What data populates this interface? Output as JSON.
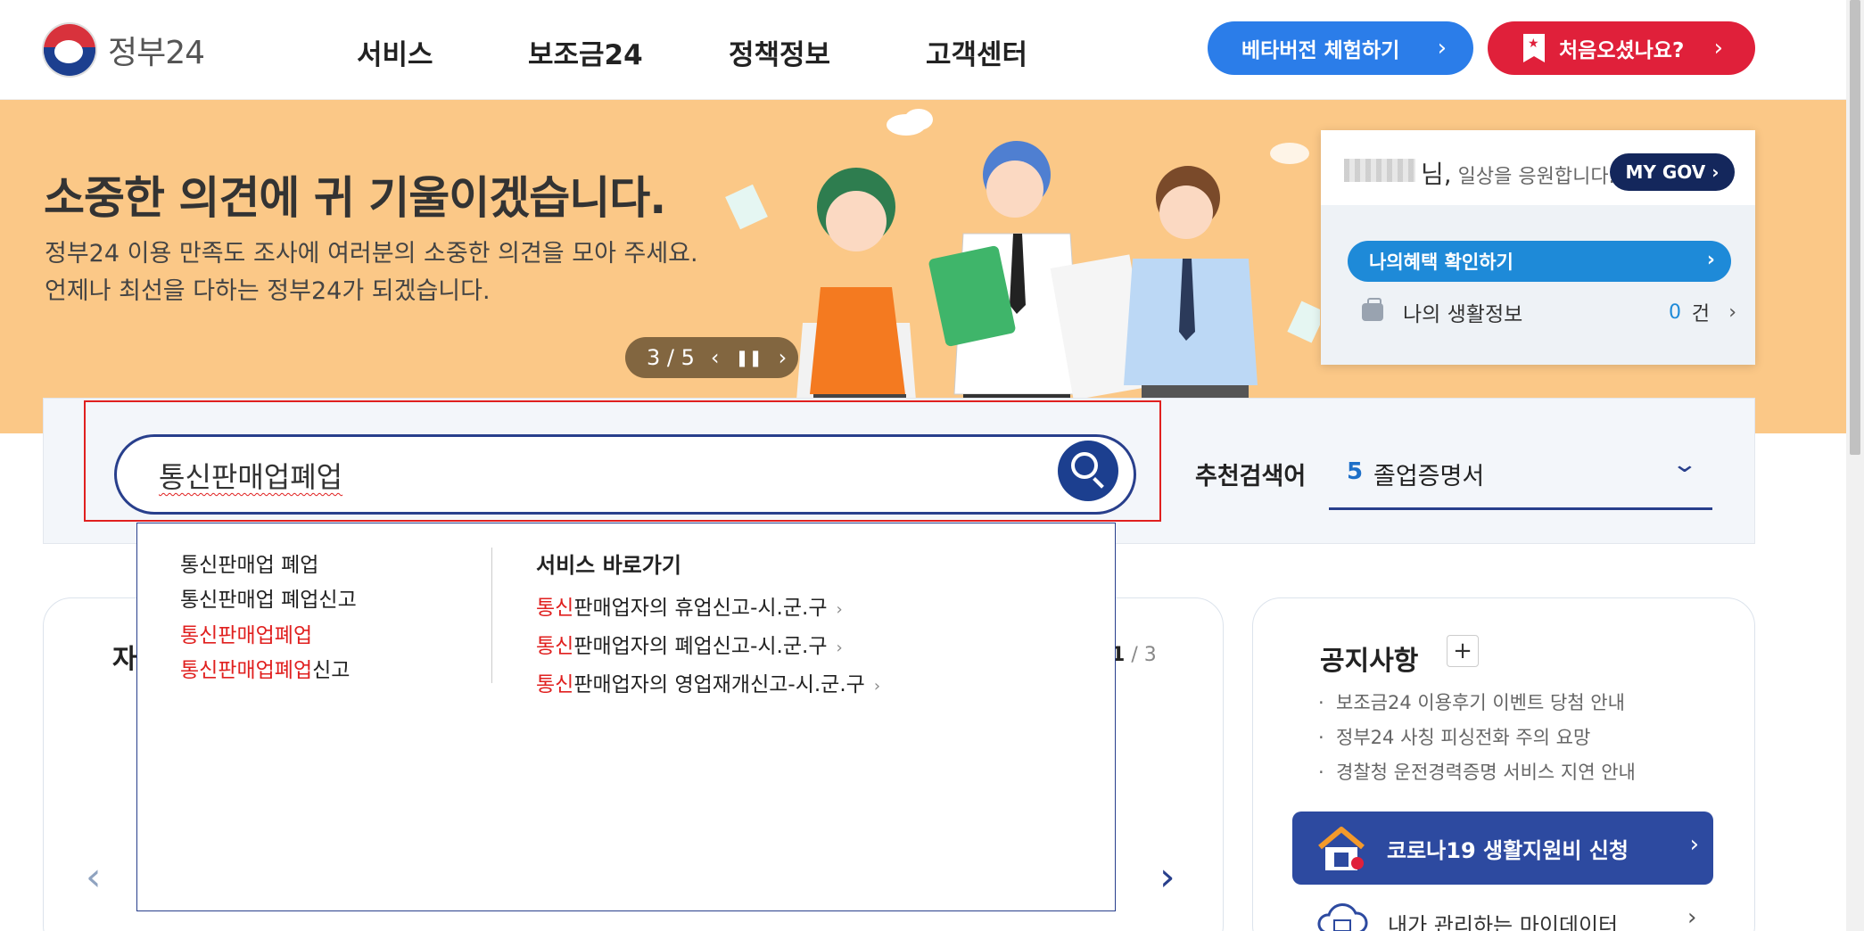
{
  "header": {
    "logo_text": "정부24",
    "nav": [
      "서비스",
      "보조금24",
      "정책정보",
      "고객센터"
    ],
    "beta_button": "베타버전 체험하기",
    "first_visit_button": "처음오셨나요?"
  },
  "banner": {
    "title": "소중한 의견에 귀 기울이겠습니다.",
    "desc_line1": "정부24 이용 만족도 조사에 여러분의 소중한 의견을 모아 주세요.",
    "desc_line2": "언제나 최선을 다하는 정부24가 되겠습니다.",
    "pager": "3 / 5"
  },
  "mygov": {
    "suffix": "님,",
    "greeting": "일상을 응원합니다.",
    "button": "MY GOV",
    "benefit_button": "나의혜택 확인하기",
    "life_info_label": "나의 생활정보",
    "life_info_count": "0",
    "life_info_unit": "건"
  },
  "search": {
    "value": "통신판매업폐업",
    "recommend_label": "추천검색어",
    "recommend_rank": "5",
    "recommend_word": "졸업증명서"
  },
  "autocomplete": {
    "suggestions": [
      {
        "pre": "",
        "hl": "",
        "post": "통신판매업 폐업"
      },
      {
        "pre": "",
        "hl": "",
        "post": "통신판매업 폐업신고"
      },
      {
        "pre": "",
        "hl": "통신판매업폐업",
        "post": ""
      },
      {
        "pre": "",
        "hl": "통신판매업폐업",
        "post": "신고"
      }
    ],
    "service_title": "서비스 바로가기",
    "services": [
      {
        "hl": "통신",
        "post": "판매업자의 휴업신고-시.군.구"
      },
      {
        "hl": "통신",
        "post": "판매업자의 폐업신고-시.군.구"
      },
      {
        "hl": "통신",
        "post": "판매업자의 영업재개신고-시.군.구"
      }
    ]
  },
  "left_card": {
    "title_visible": "자",
    "page_current": "1",
    "page_total": "/ 3"
  },
  "notice": {
    "title": "공지사항",
    "items": [
      "보조금24 이용후기 이벤트 당첨 안내",
      "정부24 사칭 피싱전화 주의 요망",
      "경찰청 운전경력증명 서비스 지연 안내"
    ],
    "covid_button": "코로나19 생활지원비 신청",
    "mydata": "내가 관리하는 마이데이터"
  },
  "colors": {
    "brand_navy": "#1c3f8f",
    "accent_blue": "#2b7de9",
    "accent_red": "#e0203a",
    "banner_bg": "#fbc887"
  }
}
